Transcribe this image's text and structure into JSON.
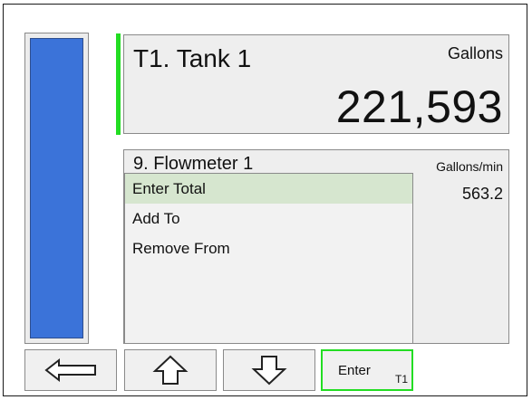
{
  "tank": {
    "name": "T1. Tank 1",
    "unit": "Gallons",
    "value": "221,593"
  },
  "flowmeter": {
    "name": "9. Flowmeter 1",
    "unit": "Gallons/min",
    "value": "563.2"
  },
  "level_bar": {
    "fill_fraction": 1.0,
    "color": "#3b73d9"
  },
  "accent_color": "#22dd22",
  "menu": {
    "items": [
      {
        "label": "Enter Total",
        "selected": true
      },
      {
        "label": "Add To",
        "selected": false
      },
      {
        "label": "Remove From",
        "selected": false
      }
    ]
  },
  "buttons": {
    "back_icon": "arrow-left-icon",
    "up_icon": "arrow-up-icon",
    "down_icon": "arrow-down-icon",
    "enter_label": "Enter",
    "enter_sub": "T1"
  }
}
